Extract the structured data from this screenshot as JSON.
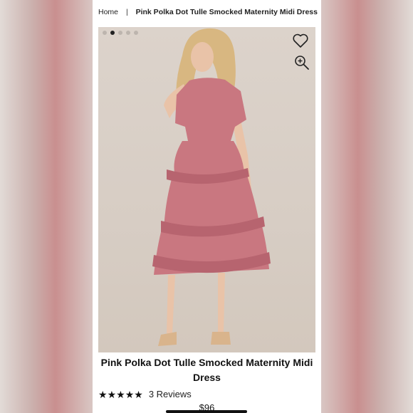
{
  "breadcrumb": {
    "home": "Home",
    "separator": "|",
    "current": "Pink Polka Dot Tulle Smocked Maternity Midi Dress"
  },
  "gallery": {
    "image_count": 5,
    "active_index": 1,
    "favorite_icon": "heart-icon",
    "zoom_icon": "zoom-in-icon"
  },
  "product": {
    "title": "Pink Polka Dot Tulle Smocked Maternity Midi Dress",
    "rating_stars": 5,
    "star_glyph": "★",
    "reviews": "3 Reviews",
    "price": "$96"
  },
  "colors": {
    "dress": "#c97780",
    "dress_shadow": "#b7646f",
    "skin": "#e9c3a8",
    "hair": "#d8b781",
    "shoes": "#d9b48c"
  }
}
